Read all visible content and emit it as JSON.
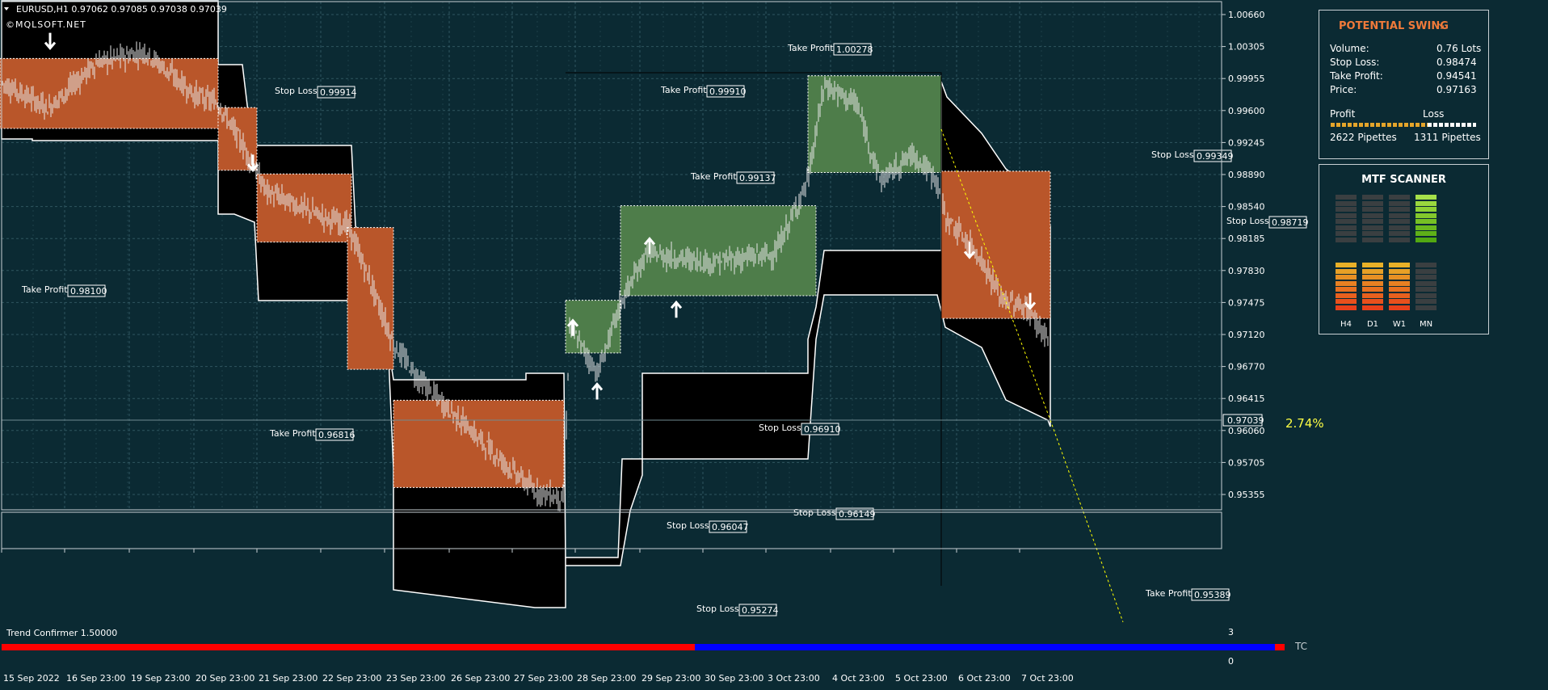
{
  "header": {
    "symbol_line": "EURUSD,H1  0.97062 0.97085 0.97038 0.97039",
    "watermark": "©MQLSOFT.NET"
  },
  "colors": {
    "background": "#0b2a33",
    "grid": "#2f5660",
    "bear_zone": "#b9562a",
    "bull_zone": "#4e7d4a",
    "black_zone": "#000000",
    "trend_red": "#ff0000",
    "trend_blue": "#0000ff",
    "swing_title": "#f07a3a",
    "percent_label": "#ffff44"
  },
  "chart_data": {
    "type": "candlestick",
    "symbol": "EURUSD",
    "timeframe": "H1",
    "ohlc_last": {
      "open": 0.97062,
      "high": 0.97085,
      "low": 0.97038,
      "close": 0.97039
    },
    "current_price_label": "0.97039",
    "y_ticks": [
      "1.00660",
      "1.00305",
      "0.99955",
      "0.99600",
      "0.99245",
      "0.98890",
      "0.98540",
      "0.98185",
      "0.97830",
      "0.97475",
      "0.97120",
      "0.96770",
      "0.96415",
      "0.96060",
      "0.95705",
      "0.95355"
    ],
    "ylim": [
      0.9518,
      1.0077
    ],
    "x_ticks": [
      "15 Sep 2022",
      "16 Sep 23:00",
      "19 Sep 23:00",
      "20 Sep 23:00",
      "21 Sep 23:00",
      "22 Sep 23:00",
      "23 Sep 23:00",
      "26 Sep 23:00",
      "27 Sep 23:00",
      "28 Sep 23:00",
      "29 Sep 23:00",
      "30 Sep 23:00",
      "3 Oct 23:00",
      "4 Oct 23:00",
      "5 Oct 23:00",
      "6 Oct 23:00",
      "7 Oct 23:00"
    ],
    "percent_label": "2.74%",
    "annotations": [
      {
        "label": "Take Profit",
        "value": "1.00278"
      },
      {
        "label": "Stop Loss",
        "value": "0.99914"
      },
      {
        "label": "Take Profit",
        "value": "0.99910"
      },
      {
        "label": "Take Profit",
        "value": "0.99137"
      },
      {
        "label": "Stop Loss",
        "value": "0.99349"
      },
      {
        "label": "Stop Loss",
        "value": "0.98719"
      },
      {
        "label": "Take Profit",
        "value": "0.98100"
      },
      {
        "label": "Take Profit",
        "value": "0.96816"
      },
      {
        "label": "Stop Loss",
        "value": "0.96910"
      },
      {
        "label": "Stop Loss",
        "value": "0.96149"
      },
      {
        "label": "Stop Loss",
        "value": "0.96047"
      },
      {
        "label": "Stop Loss",
        "value": "0.95274"
      },
      {
        "label": "Take Profit",
        "value": "0.95389"
      }
    ],
    "zones": [
      {
        "type": "bear",
        "x0": 0,
        "x1": 270,
        "y0": 0.99375,
        "y1": 1.00145,
        "inner": 0.99655
      },
      {
        "type": "bear",
        "x0": 270,
        "x1": 318,
        "y0": 0.98915,
        "y1": 0.99605
      },
      {
        "type": "bear",
        "x0": 318,
        "x1": 435,
        "y0": 0.98125,
        "y1": 0.98875
      },
      {
        "type": "bear",
        "x0": 430,
        "x1": 487,
        "y0": 0.96725,
        "y1": 0.98285
      },
      {
        "type": "bear",
        "x0": 487,
        "x1": 698,
        "y0": 0.95425,
        "y1": 0.96385
      },
      {
        "type": "bull",
        "x0": 700,
        "x1": 768,
        "y0": 0.96905,
        "y1": 0.97485
      },
      {
        "type": "bull",
        "x0": 768,
        "x1": 1010,
        "y0": 0.97535,
        "y1": 0.98525
      },
      {
        "type": "bull",
        "x0": 1000,
        "x1": 1165,
        "y0": 0.9889,
        "y1": 0.99955
      },
      {
        "type": "bear",
        "x0": 1165,
        "x1": 1300,
        "y0": 0.97285,
        "y1": 0.98905
      }
    ],
    "arrows": [
      {
        "dir": "down",
        "x": 62,
        "price": 1.0032
      },
      {
        "dir": "down",
        "x": 313,
        "price": 0.9898
      },
      {
        "dir": "up",
        "x": 709,
        "price": 0.972
      },
      {
        "dir": "up",
        "x": 739,
        "price": 0.965
      },
      {
        "dir": "up",
        "x": 804,
        "price": 0.981
      },
      {
        "dir": "up",
        "x": 837,
        "price": 0.974
      },
      {
        "dir": "down",
        "x": 1200,
        "price": 0.9802
      },
      {
        "dir": "down",
        "x": 1275,
        "price": 0.9746
      }
    ]
  },
  "potential_swing": {
    "title": "POTENTIAL SWING",
    "rows": [
      {
        "label": "Volume:",
        "value": "0.76 Lots"
      },
      {
        "label": "Stop Loss:",
        "value": "0.98474"
      },
      {
        "label": "Take Profit:",
        "value": "0.94541"
      },
      {
        "label": "Price:",
        "value": "0.97163"
      }
    ],
    "profit_label": "Profit",
    "loss_label": "Loss",
    "profit_pipettes": "2622 Pipettes",
    "loss_pipettes": "1311 Pipettes",
    "profit_fraction": 0.667
  },
  "mtf_scanner": {
    "title": "MTF SCANNER",
    "columns": [
      {
        "label": "H4",
        "bull_level": 0,
        "bear_level": 8
      },
      {
        "label": "D1",
        "bull_level": 0,
        "bear_level": 8
      },
      {
        "label": "W1",
        "bull_level": 0,
        "bear_level": 8
      },
      {
        "label": "MN",
        "bull_level": 8,
        "bear_level": 0
      }
    ]
  },
  "indicator": {
    "name": "Trend Confirmer 1.50000",
    "tag": "TC",
    "y_ticks": [
      "3",
      "0"
    ]
  }
}
